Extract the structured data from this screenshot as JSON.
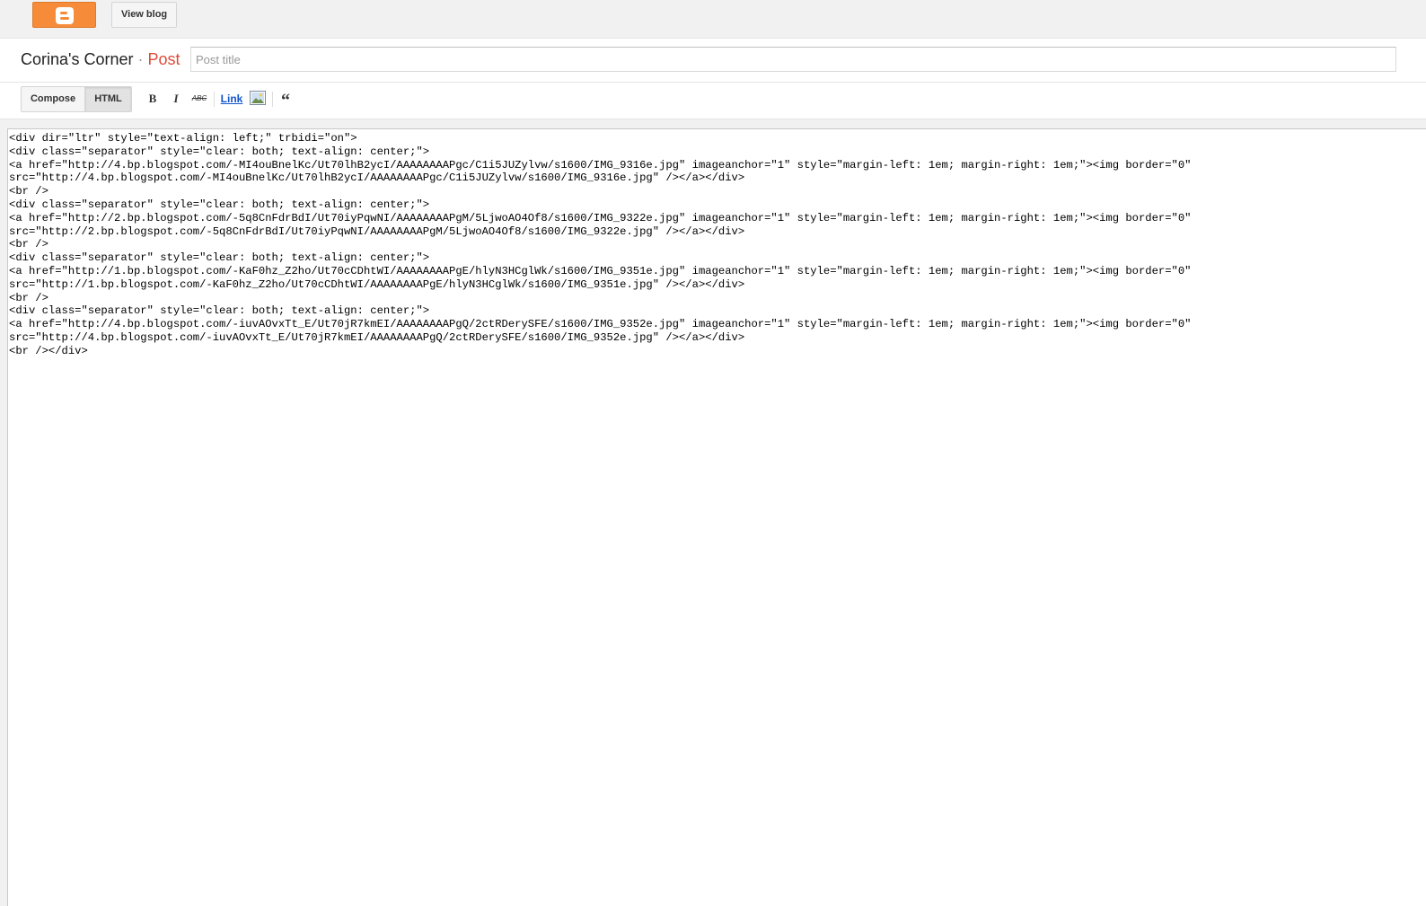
{
  "topbar": {
    "logo_icon": "blogger-logo-icon",
    "view_blog_label": "View blog"
  },
  "titlebar": {
    "blog_name": "Corina's Corner",
    "separator": "·",
    "section": "Post",
    "post_title_placeholder": "Post title",
    "post_title_value": ""
  },
  "toolbar": {
    "compose_label": "Compose",
    "html_label": "HTML",
    "active_mode": "HTML",
    "bold_label": "B",
    "italic_label": "I",
    "strike_label": "ABC",
    "link_label": "Link",
    "image_icon": "insert-image-icon",
    "quote_label": "“"
  },
  "editor": {
    "lines": [
      "<div dir=\"ltr\" style=\"text-align: left;\" trbidi=\"on\">",
      "<div class=\"separator\" style=\"clear: both; text-align: center;\">",
      "<a href=\"http://4.bp.blogspot.com/-MI4ouBnelKc/Ut70lhB2ycI/AAAAAAAAPgc/C1i5JUZylvw/s1600/IMG_9316e.jpg\" imageanchor=\"1\" style=\"margin-left: 1em; margin-right: 1em;\"><img border=\"0\"",
      "src=\"http://4.bp.blogspot.com/-MI4ouBnelKc/Ut70lhB2ycI/AAAAAAAAPgc/C1i5JUZylvw/s1600/IMG_9316e.jpg\" /></a></div>",
      "<br />",
      "<div class=\"separator\" style=\"clear: both; text-align: center;\">",
      "<a href=\"http://2.bp.blogspot.com/-5q8CnFdrBdI/Ut70iyPqwNI/AAAAAAAAPgM/5LjwoAO4Of8/s1600/IMG_9322e.jpg\" imageanchor=\"1\" style=\"margin-left: 1em; margin-right: 1em;\"><img border=\"0\"",
      "src=\"http://2.bp.blogspot.com/-5q8CnFdrBdI/Ut70iyPqwNI/AAAAAAAAPgM/5LjwoAO4Of8/s1600/IMG_9322e.jpg\" /></a></div>",
      "<br />",
      "<div class=\"separator\" style=\"clear: both; text-align: center;\">",
      "<a href=\"http://1.bp.blogspot.com/-KaF0hz_Z2ho/Ut70cCDhtWI/AAAAAAAAPgE/hlyN3HCglWk/s1600/IMG_9351e.jpg\" imageanchor=\"1\" style=\"margin-left: 1em; margin-right: 1em;\"><img border=\"0\"",
      "src=\"http://1.bp.blogspot.com/-KaF0hz_Z2ho/Ut70cCDhtWI/AAAAAAAAPgE/hlyN3HCglWk/s1600/IMG_9351e.jpg\" /></a></div>",
      "<br />",
      "<div class=\"separator\" style=\"clear: both; text-align: center;\">",
      "<a href=\"http://4.bp.blogspot.com/-iuvAOvxTt_E/Ut70jR7kmEI/AAAAAAAAPgQ/2ctRDerySFE/s1600/IMG_9352e.jpg\" imageanchor=\"1\" style=\"margin-left: 1em; margin-right: 1em;\"><img border=\"0\"",
      "src=\"http://4.bp.blogspot.com/-iuvAOvxTt_E/Ut70jR7kmEI/AAAAAAAAPgQ/2ctRDerySFE/s1600/IMG_9352e.jpg\" /></a></div>",
      "<br /></div>"
    ]
  },
  "colors": {
    "brand_orange": "#f68c3a",
    "post_accent": "#dd4b39",
    "link_blue": "#1155cc"
  }
}
